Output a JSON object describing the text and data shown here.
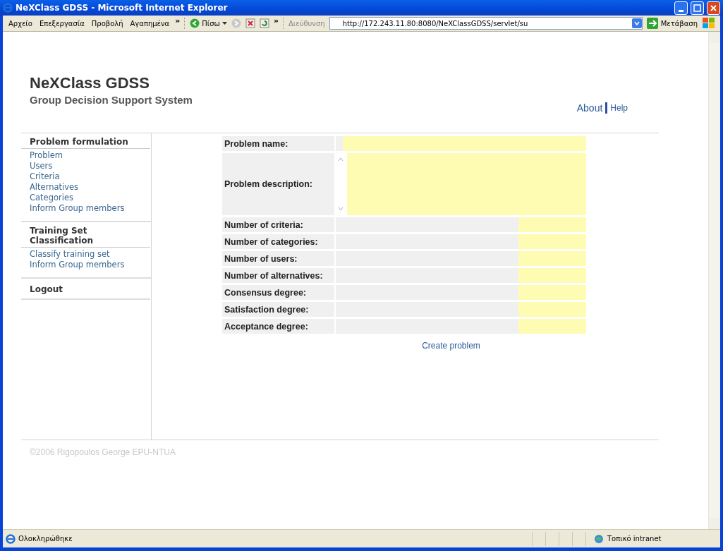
{
  "window": {
    "title": "NeXClass GDSS - Microsoft Internet Explorer"
  },
  "menu": {
    "items": [
      "Αρχείο",
      "Επεξεργασία",
      "Προβολή",
      "Αγαπημένα"
    ],
    "more": "»"
  },
  "toolbar": {
    "back": "Πίσω",
    "more": "»",
    "address_label": "Διεύθυνση",
    "address": "http://172.243.11.80:8080/NeXClassGDSS/servlet/su",
    "go": "Μετάβαση"
  },
  "header": {
    "title": "NeXClass GDSS",
    "subtitle": "Group Decision Support System",
    "links": [
      "About",
      "Help"
    ]
  },
  "sidebar": {
    "sections": [
      {
        "title": "Problem formulation",
        "items": [
          "Problem",
          "Users",
          "Criteria",
          "Alternatives",
          "Categories",
          "Inform Group members"
        ]
      },
      {
        "title": "Training Set Classification",
        "items": [
          "Classify training set",
          "Inform Group members"
        ]
      },
      {
        "title": "Logout"
      }
    ]
  },
  "form": {
    "fields": [
      {
        "label": "Problem name:",
        "kind": "text"
      },
      {
        "label": "Problem description:",
        "kind": "textarea"
      },
      {
        "label": "Number of criteria:",
        "kind": "short"
      },
      {
        "label": "Number of categories:",
        "kind": "short"
      },
      {
        "label": "Number of users:",
        "kind": "short"
      },
      {
        "label": "Number of alternatives:",
        "kind": "short"
      },
      {
        "label": "Consensus degree:",
        "kind": "short"
      },
      {
        "label": "Satisfaction degree:",
        "kind": "short"
      },
      {
        "label": "Acceptance degree:",
        "kind": "short"
      }
    ],
    "submit": "Create problem"
  },
  "footer": "©2006 Rigopoulos George EPU-NTUA",
  "status_bar": {
    "text": "Ολοκληρώθηκε",
    "zone": "Τοπικό intranet"
  }
}
